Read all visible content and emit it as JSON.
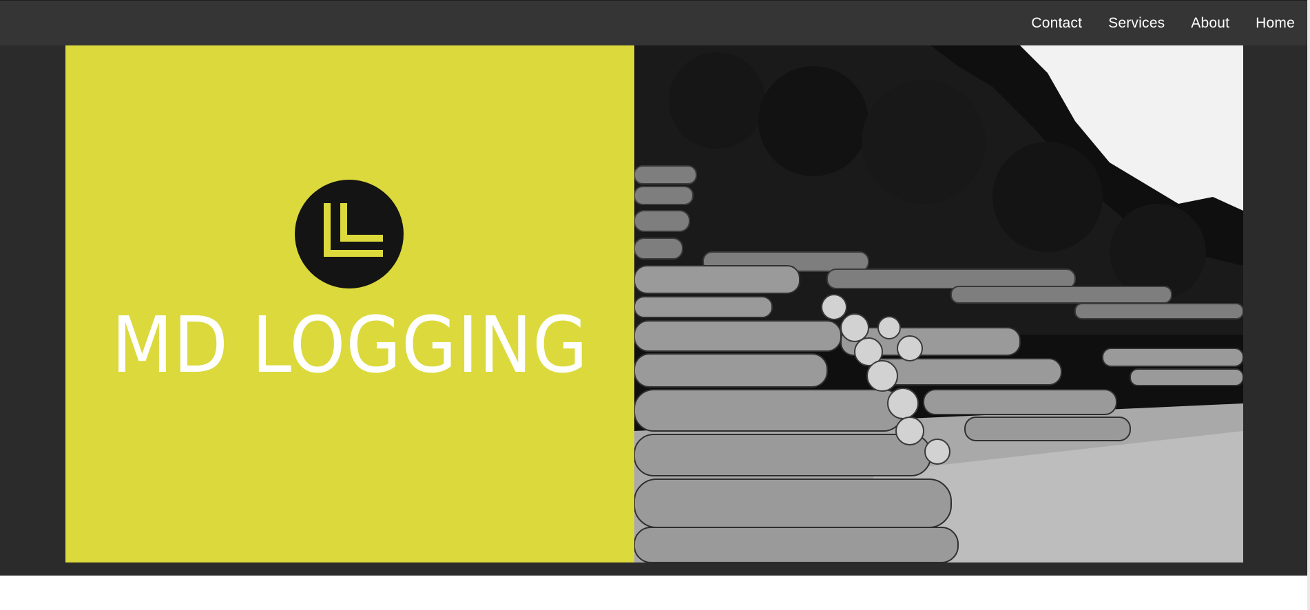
{
  "nav": {
    "items": [
      {
        "label": "Contact"
      },
      {
        "label": "Services"
      },
      {
        "label": "About"
      },
      {
        "label": "Home"
      }
    ]
  },
  "hero": {
    "brand_name": "MD LOGGING",
    "logo_icon": "double-l-logo-icon",
    "photo": "log-pile-forest-photo",
    "accent_color": "#dcd93c",
    "dark_color": "#141414"
  }
}
